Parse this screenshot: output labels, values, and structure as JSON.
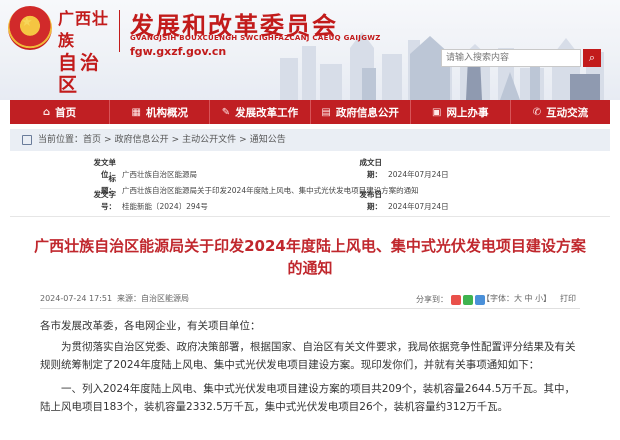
{
  "header": {
    "province_line1": "广西壮族",
    "province_line2": "自治区",
    "title": "发展和改革委员会",
    "title_en": "GVANGJSIH BOUXCUENGH SWCIGHFAZCANJ CAEUQ GAIJGWZ",
    "domain": "fgw.gxzf.gov.cn",
    "search_placeholder": "请输入搜索内容",
    "search_icon": "magnifier-icon"
  },
  "nav": [
    {
      "label": "首页",
      "icon": "⌂"
    },
    {
      "label": "机构概况",
      "icon": "▦"
    },
    {
      "label": "发展改革工作",
      "icon": "✎"
    },
    {
      "label": "政府信息公开",
      "icon": "▤"
    },
    {
      "label": "网上办事",
      "icon": "▣"
    },
    {
      "label": "互动交流",
      "icon": "✆"
    }
  ],
  "breadcrumb": {
    "prefix": "当前位置：",
    "items": [
      "首页",
      "政府信息公开",
      "主动公开文件",
      "通知公告"
    ],
    "separator": ">"
  },
  "meta": {
    "issuer_label": "发文单位：",
    "issuer": "广西壮族自治区能源局",
    "date_label": "成文日期：",
    "date": "2024年07月24日",
    "title_label": "标　　题：",
    "title": "广西壮族自治区能源局关于印发2024年度陆上风电、集中式光伏发电项目建设方案的通知",
    "docno_label": "发文字号：",
    "docno": "桂能新能〔2024〕294号",
    "pubdate_label": "发布日期：",
    "pubdate": "2024年07月24日"
  },
  "article": {
    "title_line1": "广西壮族自治区能源局关于印发2024年度陆上风电、集中式光伏发电项目建设方案",
    "title_line2": "的通知",
    "datetime": "2024-07-24 17:51",
    "source": "来源：自治区能源局",
    "share_label": "分享到：",
    "font_label": "【字体：大 中 小】",
    "print_label": "打印",
    "salutation": "各市发展改革委，各电网企业，有关项目单位：",
    "para1": "为贯彻落实自治区党委、政府决策部署，根据国家、自治区有关文件要求，我局依据竞争性配置评分结果及有关规则统筹制定了2024年度陆上风电、集中式光伏发电项目建设方案。现印发你们，并就有关事项通知如下：",
    "para2": "一、列入2024年度陆上风电、集中式光伏发电项目建设方案的项目共209个，装机容量2644.5万千瓦。其中，陆上风电项目183个，装机容量2332.5万千瓦，集中式光伏发电项目26个，装机容量约312万千瓦。"
  },
  "colors": {
    "brand_red": "#c01f23",
    "title_red": "#c0272d"
  }
}
